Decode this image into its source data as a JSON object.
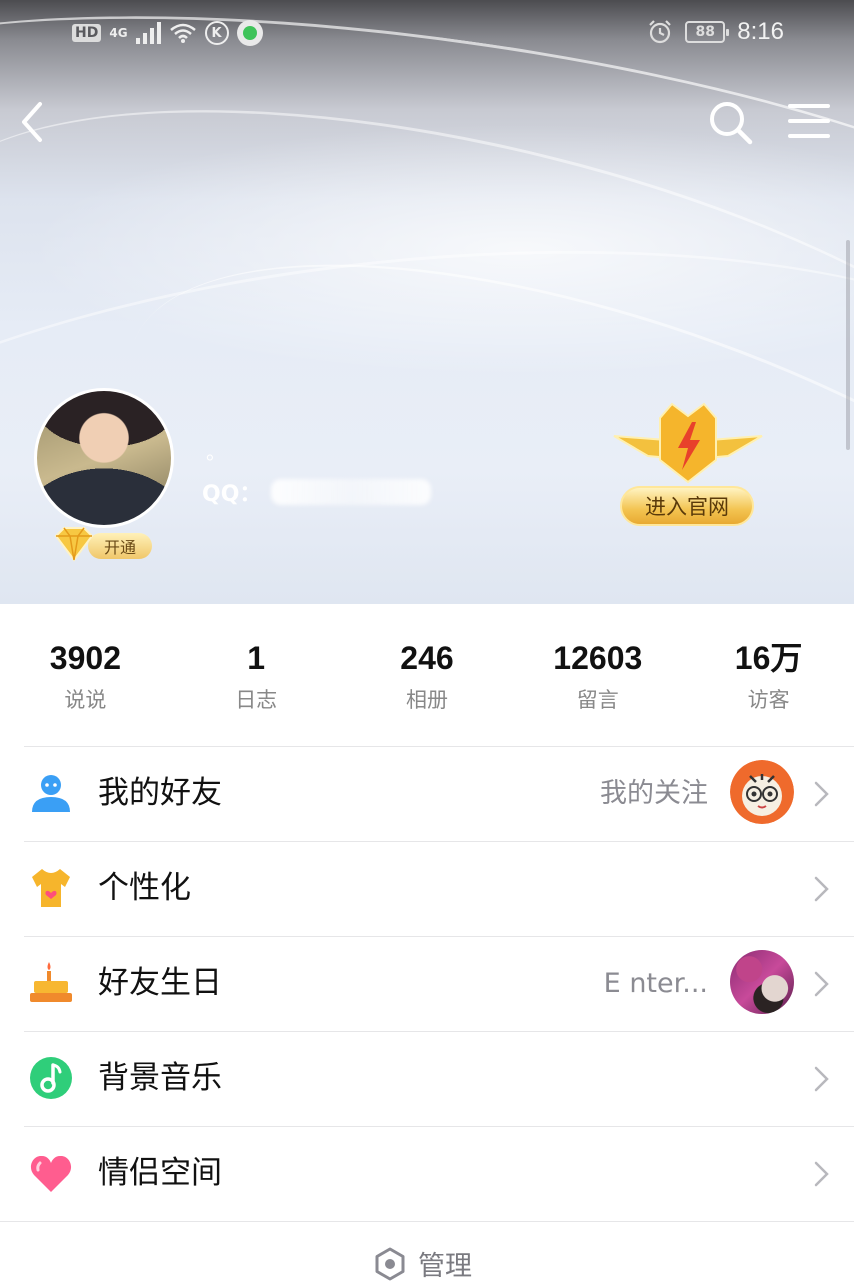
{
  "status_bar": {
    "hd": "HD",
    "network": "4G",
    "k_label": "K",
    "battery": "88",
    "time": "8:16"
  },
  "profile": {
    "nickname": "。",
    "qq_label": "QQ：",
    "vip_label": "开通",
    "official_label": "进入官网"
  },
  "stats": [
    {
      "value": "3902",
      "label": "说说"
    },
    {
      "value": "1",
      "label": "日志"
    },
    {
      "value": "246",
      "label": "相册"
    },
    {
      "value": "12603",
      "label": "留言"
    },
    {
      "value": "16万",
      "label": "访客"
    }
  ],
  "menu": [
    {
      "title": "我的好友",
      "extra": "我的关注",
      "icon": "friends-icon"
    },
    {
      "title": "个性化",
      "extra": "",
      "icon": "tshirt-icon"
    },
    {
      "title": "好友生日",
      "extra": "E nter...",
      "icon": "birthday-cake-icon"
    },
    {
      "title": "背景音乐",
      "extra": "",
      "icon": "music-note-icon"
    },
    {
      "title": "情侣空间",
      "extra": "",
      "icon": "heart-icon"
    }
  ],
  "footer": {
    "manage_label": "管理"
  },
  "colors": {
    "friends_icon": "#3a9ff5",
    "tshirt_icon": "#f6b52c",
    "cake_icon": "#f5a623",
    "music_icon": "#2fce7a",
    "heart_icon": "#ff5d8f",
    "gold": "#f3c451"
  }
}
